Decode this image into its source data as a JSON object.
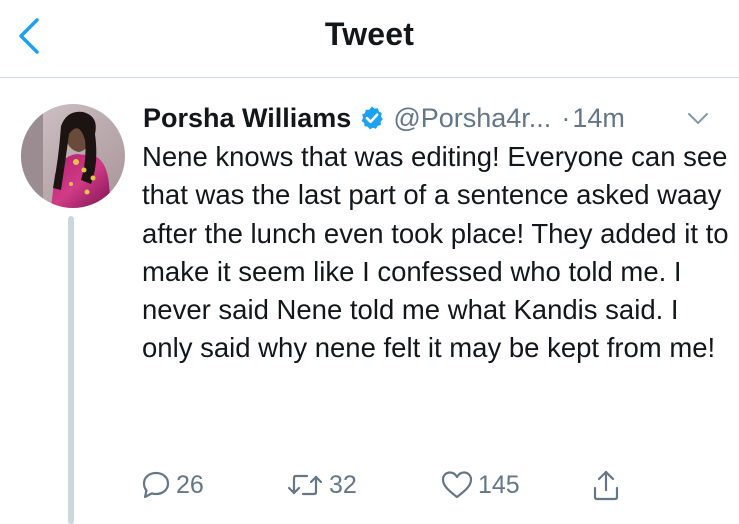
{
  "header": {
    "title": "Tweet",
    "back_icon": "chevron-left-icon",
    "accent_color": "#1da1f2"
  },
  "tweet": {
    "author_name": "Porsha Williams",
    "verified": true,
    "handle": "@Porsha4r...",
    "separator": "·",
    "time": "14m",
    "text": "Nene knows that was editing! Everyone can see that was the last part of a sentence asked waay after the lunch even took place! They added it to make it seem like I confessed who told me. I never said Nene told me what Kandis said. I only said why nene felt it may be kept from me!",
    "actions": {
      "replies": "26",
      "retweets": "32",
      "likes": "145"
    }
  },
  "colors": {
    "text_primary": "#14171a",
    "text_secondary": "#657786",
    "verified_badge": "#1da1f2",
    "divider": "#d6dbdf",
    "thread_line": "#ccd6dd"
  }
}
